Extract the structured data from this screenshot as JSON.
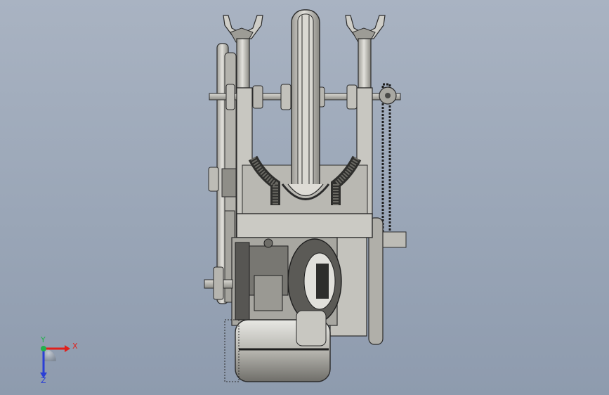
{
  "viewport": {
    "background_top": "#a9b3c2",
    "background_bottom": "#8e9bae"
  },
  "model": {
    "part_fill": "#c9c8c2",
    "part_shade": "#8f8e88",
    "edge_color": "#2b2b2b",
    "dark_fill": "#3c3c3a"
  },
  "triad": {
    "x_label": "X",
    "y_label": "Y",
    "z_label": "Z",
    "x_color": "#e0201b",
    "y_color": "#22b14c",
    "z_color": "#2a3fd6"
  }
}
